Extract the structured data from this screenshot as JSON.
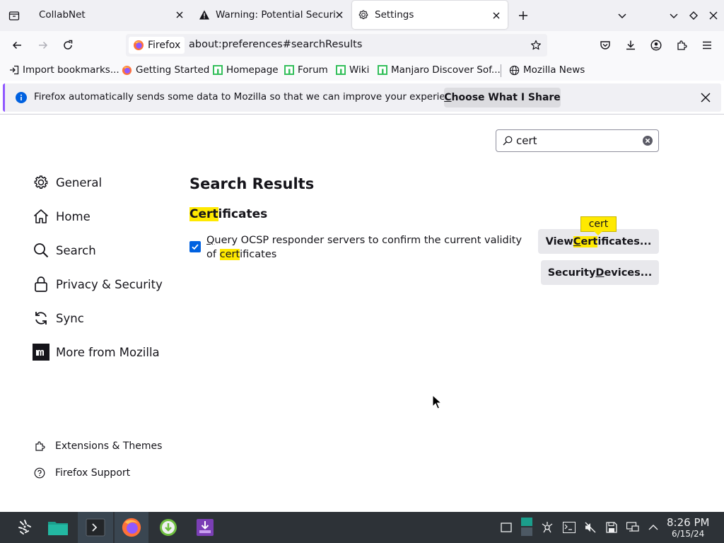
{
  "tabs": [
    {
      "label": "CollabNet",
      "icon": "none"
    },
    {
      "label": "Warning: Potential Security Risk Ahead",
      "icon": "warning-icon"
    },
    {
      "label": "Settings",
      "icon": "gear-icon",
      "selected": true
    }
  ],
  "urlbar": {
    "identity_label": "Firefox",
    "url": "about:preferences#searchResults"
  },
  "bookmarks": [
    {
      "label": "Import bookmarks...",
      "icon": "import-icon"
    },
    {
      "label": "Getting Started",
      "icon": "firefox-icon"
    },
    {
      "label": "Homepage",
      "icon": "manjaro-icon"
    },
    {
      "label": "Forum",
      "icon": "manjaro-icon"
    },
    {
      "label": "Wiki",
      "icon": "manjaro-icon"
    },
    {
      "label": "Manjaro Discover Sof...",
      "icon": "manjaro-icon"
    },
    {
      "label": "Mozilla News",
      "icon": "globe-icon"
    }
  ],
  "notification": {
    "text": "Firefox automatically sends some data to Mozilla so that we can improve your experience.",
    "button_ul": "C",
    "button_rest": "hoose What I Share"
  },
  "search": {
    "value": "cert"
  },
  "sidebar": {
    "categories": [
      {
        "label": "General",
        "icon": "gear-icon"
      },
      {
        "label": "Home",
        "icon": "home-icon"
      },
      {
        "label": "Search",
        "icon": "search-icon"
      },
      {
        "label": "Privacy & Security",
        "icon": "lock-icon"
      },
      {
        "label": "Sync",
        "icon": "sync-icon"
      },
      {
        "label": "More from Mozilla",
        "icon": "mozilla-icon"
      }
    ],
    "footer": [
      {
        "label": "Extensions & Themes",
        "icon": "puzzle-icon"
      },
      {
        "label": "Firefox Support",
        "icon": "help-icon"
      }
    ]
  },
  "results": {
    "title": "Search Results",
    "group_hl": "Cert",
    "group_rest": "ificates",
    "ocsp_ul": "Q",
    "ocsp_mid": "uery OCSP responder servers to confirm the current validity of ",
    "ocsp_hl": "cert",
    "ocsp_rest": "ificates",
    "ocsp_checked": true,
    "view_btn": {
      "pre": "View ",
      "ul": "C",
      "hl_rest": "ert",
      "rest": "ificates..."
    },
    "devices_btn": {
      "pre": "Security ",
      "ul": "D",
      "rest": "evices..."
    },
    "tooltip": "cert"
  },
  "clock": {
    "time": "8:26 PM",
    "date": "6/15/24"
  },
  "colors": {
    "accent": "#0061e0",
    "highlight": "#ffe900",
    "notification_bar": "#9059ff",
    "taskbar": "#2d3237"
  }
}
